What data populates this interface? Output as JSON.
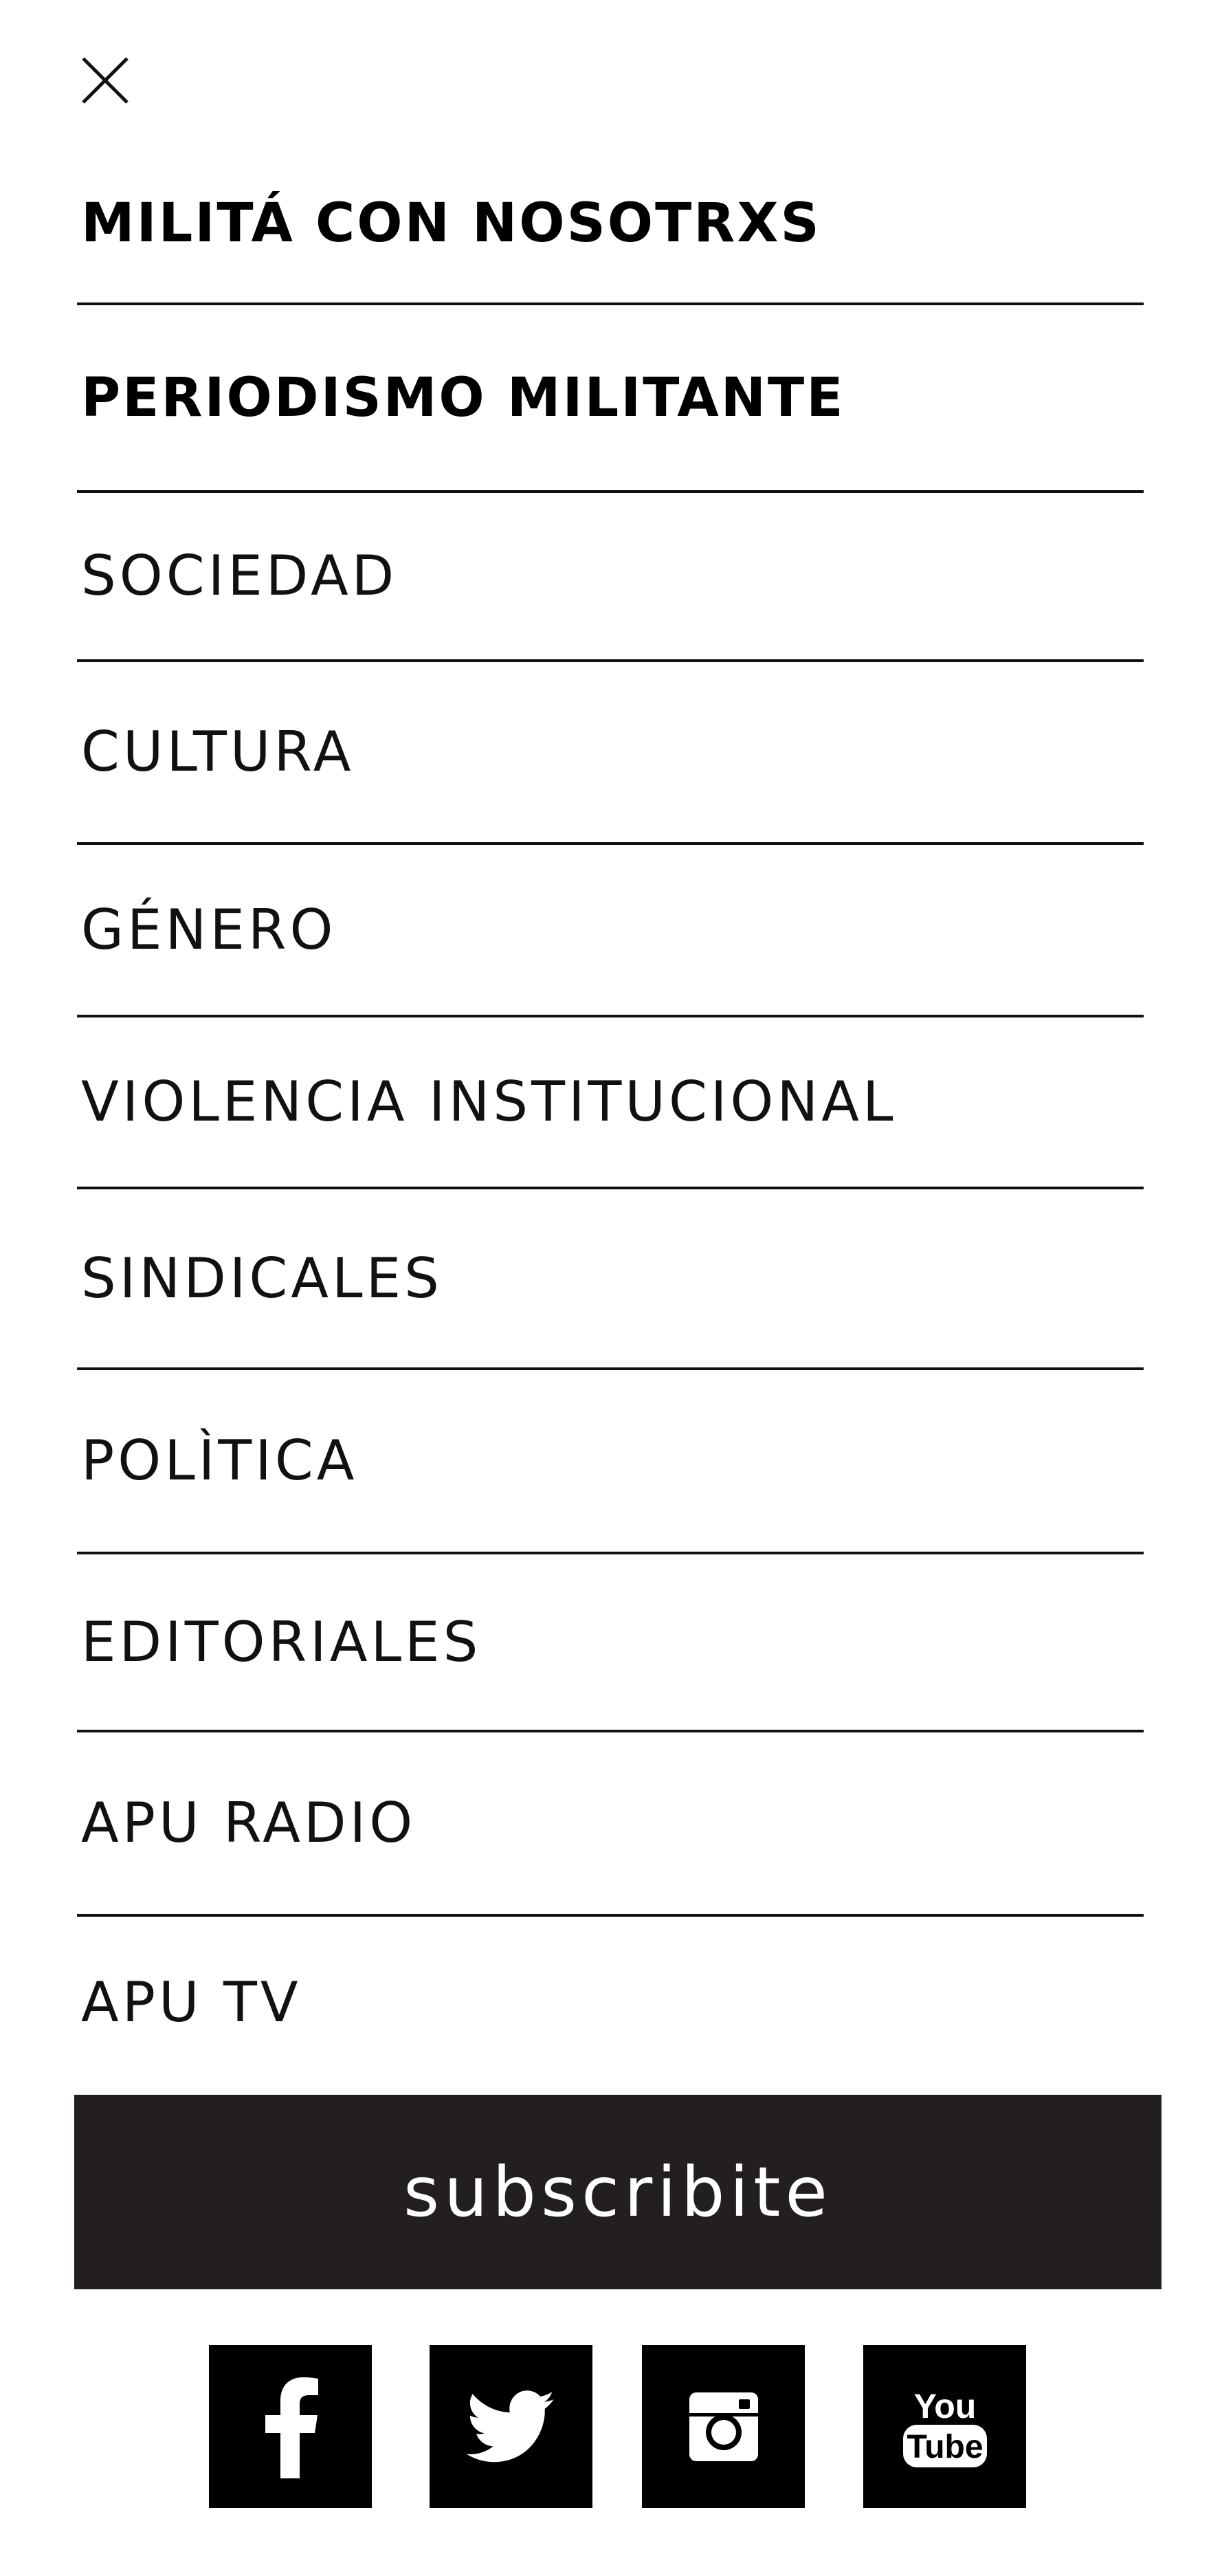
{
  "menu": {
    "items": [
      {
        "label": "MILITÁ CON NOSOTRXS"
      },
      {
        "label": "PERIODISMO MILITANTE"
      },
      {
        "label": "SOCIEDAD"
      },
      {
        "label": "CULTURA"
      },
      {
        "label": "GÉNERO"
      },
      {
        "label": "VIOLENCIA INSTITUCIONAL"
      },
      {
        "label": "SINDICALES"
      },
      {
        "label": "POLÌTICA"
      },
      {
        "label": "EDITORIALES"
      },
      {
        "label": "APU RADIO"
      },
      {
        "label": "APU TV"
      }
    ]
  },
  "subscribe": {
    "label": "subscribite",
    "background": "#231f20",
    "text_color": "#ffffff"
  },
  "social": {
    "icons": [
      "facebook-icon",
      "twitter-icon",
      "instagram-icon",
      "youtube-icon"
    ],
    "youtube_text": [
      "You",
      "Tube"
    ],
    "background": "#000000"
  },
  "close_icon": "close-icon"
}
